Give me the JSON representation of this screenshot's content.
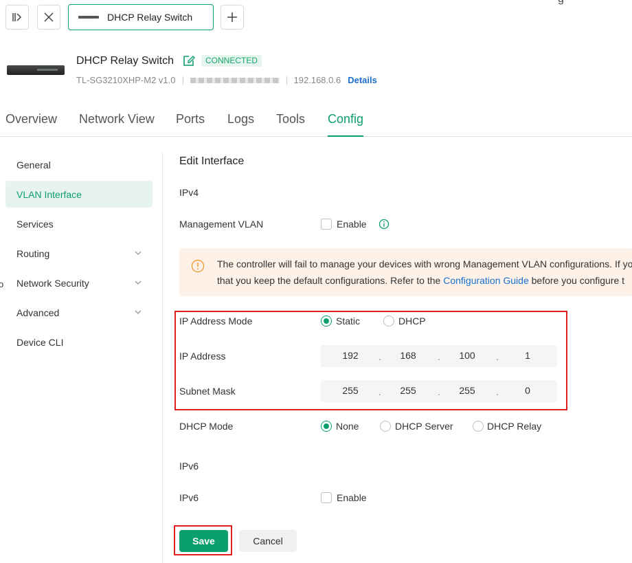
{
  "topbar": {
    "device_tab_label": "DHCP Relay Switch",
    "partial_text": "g"
  },
  "device": {
    "name": "DHCP Relay Switch",
    "status": "CONNECTED",
    "model": "TL-SG3210XHP-M2 v1.0",
    "ip": "192.168.0.6",
    "details_link": "Details"
  },
  "tabs": [
    "Overview",
    "Network View",
    "Ports",
    "Logs",
    "Tools",
    "Config"
  ],
  "active_tab": "Config",
  "sidebar": {
    "edge_char": "o",
    "items": [
      {
        "label": "General"
      },
      {
        "label": "VLAN Interface"
      },
      {
        "label": "Services"
      },
      {
        "label": "Routing"
      },
      {
        "label": "Network Security"
      },
      {
        "label": "Advanced"
      },
      {
        "label": "Device CLI"
      }
    ]
  },
  "form": {
    "title": "Edit Interface",
    "ipv4_section": "IPv4",
    "mgmt_vlan_label": "Management VLAN",
    "enable_label": "Enable",
    "warning": {
      "line1": "The controller will fail to manage your devices with wrong Management VLAN configurations. If yo",
      "line2_pre": "that you keep the default configurations. Refer to the ",
      "link": "Configuration Guide",
      "line2_post": " before you configure t"
    },
    "ip_mode_label": "IP Address Mode",
    "ip_mode_static": "Static",
    "ip_mode_dhcp": "DHCP",
    "ip_address_label": "IP Address",
    "ip_octets": [
      "192",
      "168",
      "100",
      "1"
    ],
    "subnet_label": "Subnet Mask",
    "subnet_octets": [
      "255",
      "255",
      "255",
      "0"
    ],
    "octet_dot": ".",
    "dhcp_mode_label": "DHCP Mode",
    "dhcp_none": "None",
    "dhcp_server": "DHCP Server",
    "dhcp_relay": "DHCP Relay",
    "ipv6_section": "IPv6",
    "ipv6_label": "IPv6",
    "ipv6_enable": "Enable"
  },
  "buttons": {
    "save": "Save",
    "cancel": "Cancel"
  },
  "colors": {
    "accent": "#0b9f6b",
    "highlight_box": "#e0201f",
    "link": "#1a6fd0"
  }
}
